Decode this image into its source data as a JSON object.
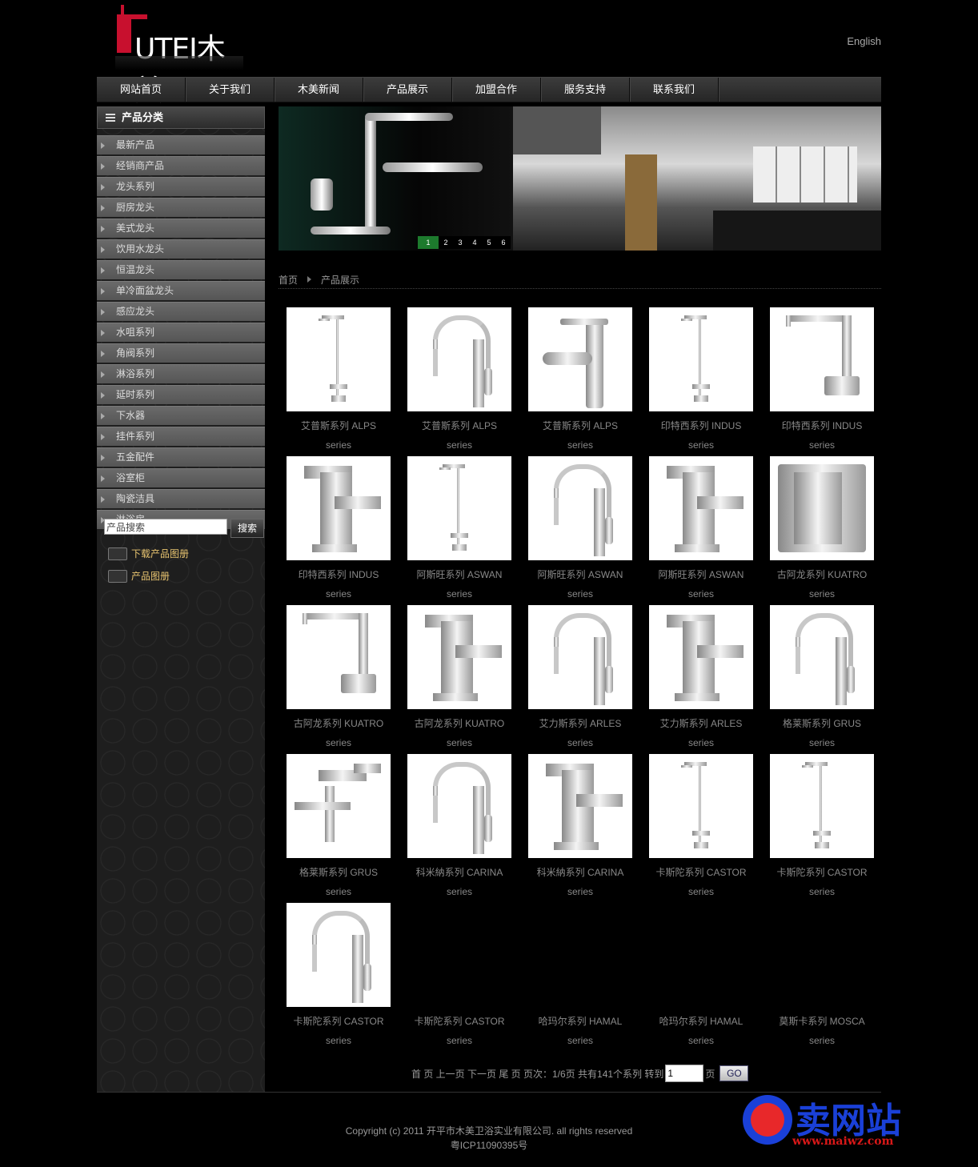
{
  "header": {
    "logo_text": "UTEI木美",
    "lang_link": "English"
  },
  "nav": [
    "网站首页",
    "关于我们",
    "木美新闻",
    "产品展示",
    "加盟合作",
    "服务支持",
    "联系我们"
  ],
  "sidebar": {
    "title": "产品分类",
    "categories": [
      "最新产品",
      "经销商产品",
      "龙头系列",
      "厨房龙头",
      "美式龙头",
      "饮用水龙头",
      "恒温龙头",
      "单冷面盆龙头",
      "感应龙头",
      "水咀系列",
      "角阀系列",
      "淋浴系列",
      "延时系列",
      "下水器",
      "挂件系列",
      "五金配件",
      "浴室柜",
      "陶瓷洁具",
      "淋浴房"
    ],
    "search_placeholder": "产品搜索",
    "search_button": "搜索",
    "links": [
      "下载产品图册",
      "产品图册"
    ]
  },
  "banner": {
    "pages": [
      "1",
      "2",
      "3",
      "4",
      "5",
      "6"
    ],
    "active_page": 1
  },
  "breadcrumb": [
    "首页",
    "产品展示"
  ],
  "products": [
    {
      "name": "艾普斯系列 ALPS",
      "sub": "series",
      "shape": "shower"
    },
    {
      "name": "艾普斯系列 ALPS",
      "sub": "series",
      "shape": "gooseneck"
    },
    {
      "name": "艾普斯系列 ALPS",
      "sub": "series",
      "shape": "basin"
    },
    {
      "name": "印特西系列 INDUS",
      "sub": "series",
      "shape": "shower"
    },
    {
      "name": "印特西系列 INDUS",
      "sub": "series",
      "shape": "lneck"
    },
    {
      "name": "印特西系列 INDUS",
      "sub": "series",
      "shape": "square"
    },
    {
      "name": "阿斯旺系列 ASWAN",
      "sub": "series",
      "shape": "shower"
    },
    {
      "name": "阿斯旺系列 ASWAN",
      "sub": "series",
      "shape": "gooseneck"
    },
    {
      "name": "阿斯旺系列 ASWAN",
      "sub": "series",
      "shape": "square"
    },
    {
      "name": "古阿龙系列 KUATRO",
      "sub": "series",
      "shape": "panel"
    },
    {
      "name": "古阿龙系列 KUATRO",
      "sub": "series",
      "shape": "lneck"
    },
    {
      "name": "古阿龙系列 KUATRO",
      "sub": "series",
      "shape": "square"
    },
    {
      "name": "艾力斯系列 ARLES",
      "sub": "series",
      "shape": "gooseneck"
    },
    {
      "name": "艾力斯系列 ARLES",
      "sub": "series",
      "shape": "square"
    },
    {
      "name": "格莱斯系列 GRUS",
      "sub": "series",
      "shape": "gooseneck"
    },
    {
      "name": "格莱斯系列 GRUS",
      "sub": "series",
      "shape": "cross"
    },
    {
      "name": "科米納系列 CARINA",
      "sub": "series",
      "shape": "gooseneck"
    },
    {
      "name": "科米納系列 CARINA",
      "sub": "series",
      "shape": "square"
    },
    {
      "name": "卡斯陀系列 CASTOR",
      "sub": "series",
      "shape": "shower"
    },
    {
      "name": "卡斯陀系列 CASTOR",
      "sub": "series",
      "shape": "shower"
    },
    {
      "name": "卡斯陀系列 CASTOR",
      "sub": "series",
      "shape": "gooseneck"
    },
    {
      "name": "卡斯陀系列 CASTOR",
      "sub": "series",
      "shape": "none"
    },
    {
      "name": "哈玛尔系列 HAMAL",
      "sub": "series",
      "shape": "none"
    },
    {
      "name": "哈玛尔系列 HAMAL",
      "sub": "series",
      "shape": "none"
    },
    {
      "name": "莫斯卡系列 MOSCA",
      "sub": "series",
      "shape": "none"
    }
  ],
  "pager": {
    "text": "首 页 上一页 下一页 尾 页 页次：1/6页 共有141个系列 转到",
    "page_value": "1",
    "page_suffix": "页",
    "go": "GO"
  },
  "footer": {
    "copyright": "Copyright (c) 2011 开平市木美卫浴实业有限公司. all rights reserved",
    "icp": "粤ICP11090395号"
  },
  "watermark": {
    "title": "卖网站",
    "url": "www.maiwz.com"
  }
}
